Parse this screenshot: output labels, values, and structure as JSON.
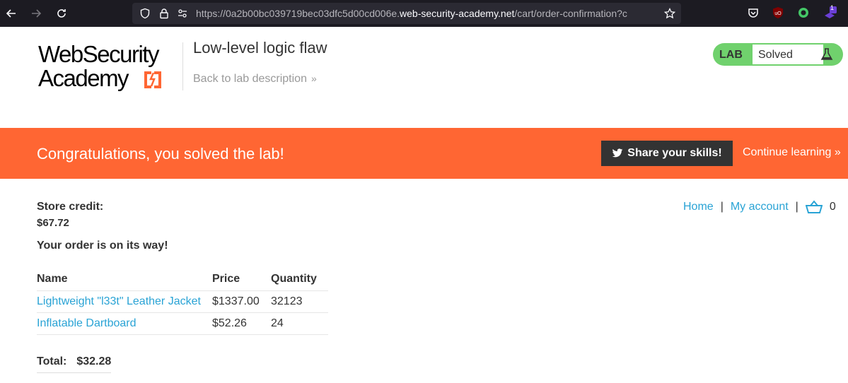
{
  "browser": {
    "url_prefix": "https://0a2b00bc039719bec03dfc5d00cd006e.",
    "url_domain": "web-security-academy.net",
    "url_path": "/cart/order-confirmation?c",
    "extension_badge": "1"
  },
  "header": {
    "logo_line1": "WebSecurity",
    "logo_line2": "Academy",
    "lab_title": "Low-level logic flaw",
    "back_link": "Back to lab description",
    "lab_label": "LAB",
    "lab_status": "Solved"
  },
  "banner": {
    "message": "Congratulations, you solved the lab!",
    "share_label": "Share your skills!",
    "continue_label": "Continue learning"
  },
  "nav": {
    "home": "Home",
    "separator": "|",
    "my_account": "My account",
    "cart_count": "0"
  },
  "account": {
    "credit_label": "Store credit:",
    "credit_value": "$67.72",
    "order_message": "Your order is on its way!"
  },
  "order": {
    "headers": [
      "Name",
      "Price",
      "Quantity"
    ],
    "rows": [
      {
        "name": "Lightweight \"l33t\" Leather Jacket",
        "price": "$1337.00",
        "quantity": "32123"
      },
      {
        "name": "Inflatable Dartboard",
        "price": "$52.26",
        "quantity": "24"
      }
    ],
    "total_label": "Total:",
    "total_value": "$32.28"
  },
  "colors": {
    "accent": "#ff6633",
    "link": "#29a3d5",
    "lab_green": "#70d16d",
    "browser_bg": "#1c1b22"
  }
}
